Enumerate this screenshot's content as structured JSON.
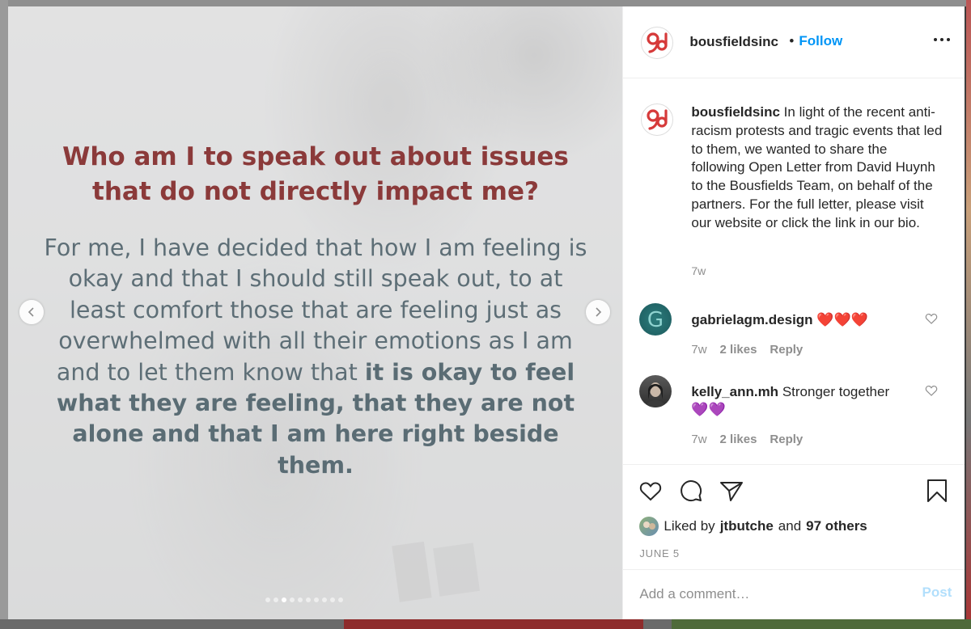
{
  "post": {
    "headline": "Who am I to speak out about issues that do not directly impact me?",
    "body_plain": "For me, I have decided that how I am feeling is okay and that I should still speak out, to at least comfort those that are feeling just as overwhelmed with all their emotions as I am and to let them know that",
    "body_bold": "it is okay to feel what they are feeling, that they are not alone and that I am here right beside them.",
    "carousel": {
      "total_slides": 10,
      "active_slide": 3
    }
  },
  "header": {
    "username": "bousfieldsinc",
    "separator": "•",
    "follow_label": "Follow"
  },
  "caption": {
    "username": "bousfieldsinc",
    "text": "In light of the recent anti-racism protests and tragic events that led to them, we wanted to share the following Open Letter from David Huynh to the Bousfields Team, on behalf of the partners. For the full letter, please visit our website or click the link in our bio.",
    "time": "7w"
  },
  "comments": [
    {
      "username": "gabrielagm.design",
      "text": "❤️❤️❤️",
      "time": "7w",
      "likes": "2 likes",
      "reply": "Reply"
    },
    {
      "username": "kelly_ann.mh",
      "text": "Stronger together 💜💜",
      "time": "7w",
      "likes": "2 likes",
      "reply": "Reply"
    }
  ],
  "likes": {
    "prefix": "Liked by",
    "user": "jtbutche",
    "conjunction": "and",
    "others": "97 others"
  },
  "date": "JUNE 5",
  "add_comment": {
    "placeholder": "Add a comment…",
    "post_label": "Post"
  },
  "colors": {
    "follow": "#0095f6",
    "headline": "#8b3a3a",
    "body": "#5d6e76",
    "logo_red": "#d63a3a",
    "post_disabled": "#b2dffc"
  }
}
